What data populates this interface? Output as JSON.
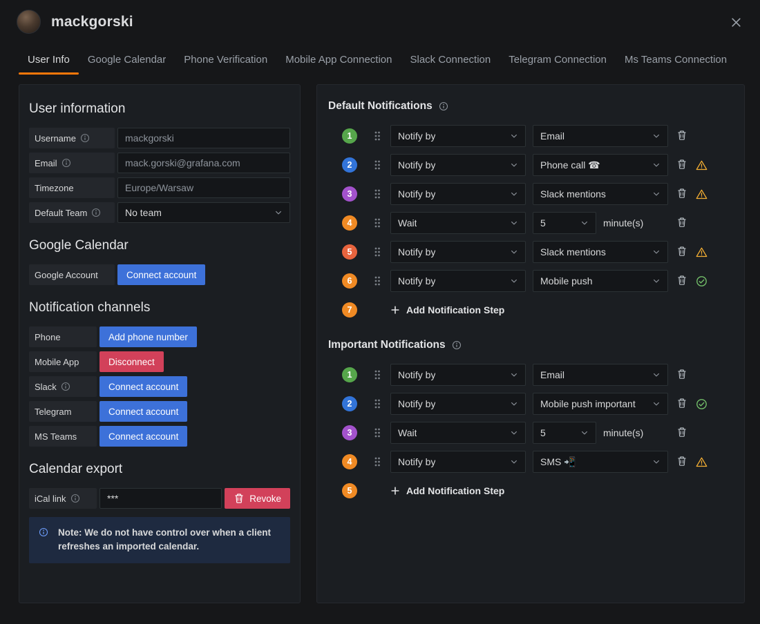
{
  "colors": {
    "accent": "#ff780a",
    "primary": "#3d71d9",
    "destructive": "#d2415a",
    "warning": "#f8b133",
    "success": "#73bf69",
    "note_icon": "#6e9fff"
  },
  "header": {
    "title": "mackgorski"
  },
  "tabs": [
    {
      "label": "User Info",
      "active": true
    },
    {
      "label": "Google Calendar"
    },
    {
      "label": "Phone Verification"
    },
    {
      "label": "Mobile App Connection"
    },
    {
      "label": "Slack Connection"
    },
    {
      "label": "Telegram Connection"
    },
    {
      "label": "Ms Teams Connection"
    }
  ],
  "left": {
    "user_info_heading": "User information",
    "fields": [
      {
        "label": "Username",
        "value": "mackgorski"
      },
      {
        "label": "Email",
        "value": "mack.gorski@grafana.com"
      },
      {
        "label": "Timezone",
        "value": "Europe/Warsaw"
      },
      {
        "label": "Default Team",
        "value": "No team"
      }
    ],
    "google_heading": "Google Calendar",
    "google_account_label": "Google Account",
    "google_connect_button": "Connect account",
    "channels_heading": "Notification channels",
    "channels": [
      {
        "label": "Phone",
        "button": "Add phone number"
      },
      {
        "label": "Mobile App",
        "button": "Disconnect"
      },
      {
        "label": "Slack",
        "button": "Connect account"
      },
      {
        "label": "Telegram",
        "button": "Connect account"
      },
      {
        "label": "MS Teams",
        "button": "Connect account"
      }
    ],
    "calendar_heading": "Calendar export",
    "ical_label": "iCal link",
    "ical_value": "***",
    "revoke_button": "Revoke",
    "note_text": "Note: We do not have control over when a client refreshes an imported calendar."
  },
  "dn": {
    "title": "Default Notifications",
    "add_label": "Add Notification Step",
    "steps": [
      {
        "num": "1",
        "color": "#56a64b",
        "first": "Notify by",
        "second": "Email"
      },
      {
        "num": "2",
        "color": "#3274d9",
        "first": "Notify by",
        "second": "Phone call ☎"
      },
      {
        "num": "3",
        "color": "#a352cc",
        "first": "Notify by",
        "second": "Slack mentions"
      },
      {
        "num": "4",
        "color": "#f08a24",
        "first": "Wait",
        "wait_value": "5",
        "wait_suffix": "minute(s)"
      },
      {
        "num": "5",
        "color": "#e8643e",
        "first": "Notify by",
        "second": "Slack mentions"
      },
      {
        "num": "6",
        "color": "#f08a24",
        "first": "Notify by",
        "second": "Mobile push"
      },
      {
        "num": "7",
        "color": "#f08a24"
      }
    ]
  },
  "imp": {
    "title": "Important Notifications",
    "add_label": "Add Notification Step",
    "steps": [
      {
        "num": "1",
        "color": "#56a64b",
        "first": "Notify by",
        "second": "Email"
      },
      {
        "num": "2",
        "color": "#3274d9",
        "first": "Notify by",
        "second": "Mobile push important"
      },
      {
        "num": "3",
        "color": "#a352cc",
        "first": "Wait",
        "wait_value": "5",
        "wait_suffix": "minute(s)"
      },
      {
        "num": "4",
        "color": "#f08a24",
        "first": "Notify by",
        "second": "SMS 📲"
      },
      {
        "num": "5",
        "color": "#f08a24"
      }
    ]
  }
}
